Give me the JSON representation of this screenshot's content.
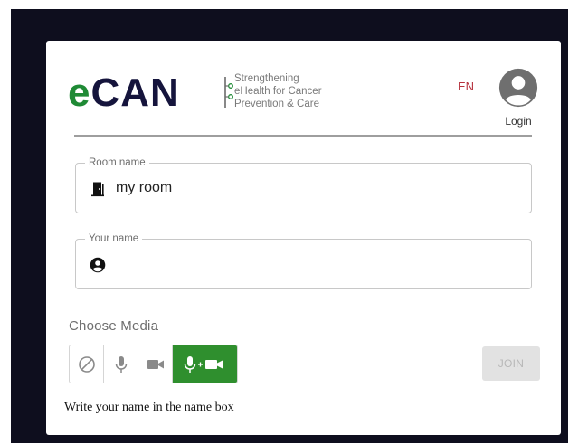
{
  "header": {
    "logo": {
      "e": "e",
      "rest": "CAN"
    },
    "tagline": [
      "Strengthening",
      "eHealth for Cancer",
      "Prevention & Care"
    ],
    "language": "EN",
    "login_label": "Login"
  },
  "form": {
    "room": {
      "label": "Room name",
      "value": "my room",
      "icon": "door-icon"
    },
    "name": {
      "label": "Your name",
      "value": "",
      "icon": "person-icon"
    }
  },
  "media": {
    "label": "Choose Media",
    "options": [
      {
        "id": "none",
        "icon": "block-icon",
        "selected": false
      },
      {
        "id": "audio",
        "icon": "microphone-icon",
        "selected": false
      },
      {
        "id": "video",
        "icon": "video-camera-icon",
        "selected": false
      },
      {
        "id": "audio-video",
        "icon": "microphone-plus-camera-icon",
        "selected": true
      }
    ]
  },
  "join": {
    "label": "JOIN",
    "enabled": false
  },
  "hint": "Write your name in the name box",
  "colors": {
    "brand_green": "#1f8a35",
    "brand_navy": "#15143c",
    "accent_red": "#b5303c",
    "media_selected": "#2f8f2e",
    "backdrop": "#0e0e1e"
  }
}
